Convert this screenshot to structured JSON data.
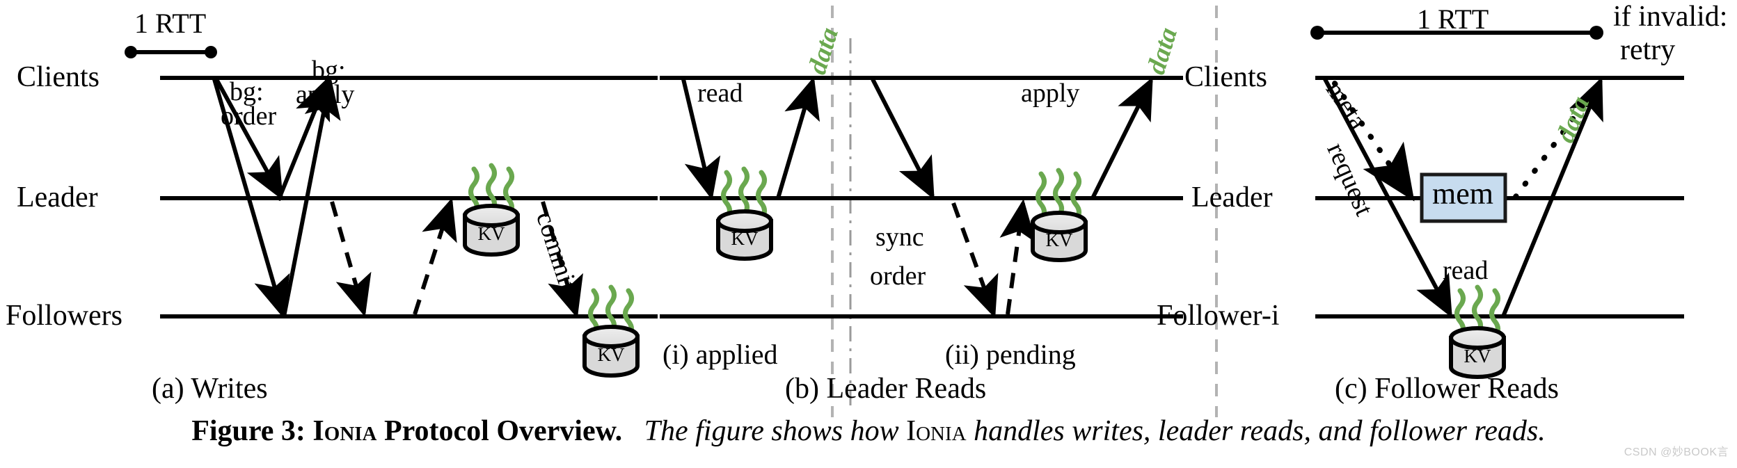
{
  "figure": {
    "caption_prefix": "Figure 3:",
    "caption_name": "Ionia",
    "caption_bold_tail": "Protocol Overview.",
    "caption_italic_a": "The figure shows how",
    "caption_italic_name": "Ionia",
    "caption_italic_b": "handles writes, leader reads, and follower reads.",
    "watermark": "CSDN @妙BOOK言"
  },
  "colors": {
    "line": "#000000",
    "green": "#6aa84f",
    "mem_fill": "#c7dcef",
    "mem_stroke": "#1a1a1a",
    "kv_fill": "#d9d9d9",
    "kv_stroke": "#000000",
    "divider": "#b3b3b3"
  },
  "panel_a": {
    "caption": "(a) Writes",
    "rtt_label": "1 RTT",
    "rows": [
      {
        "label": "Clients"
      },
      {
        "label": "Leader"
      },
      {
        "label": "Followers"
      }
    ],
    "messages": [
      {
        "label": "bg:",
        "kind": "dashed"
      },
      {
        "label": "order",
        "kind": "dashed"
      },
      {
        "label": "bg:",
        "kind": "dashed"
      },
      {
        "label": "apply",
        "kind": "dashed"
      },
      {
        "label": "commit",
        "kind": "dashed"
      }
    ],
    "store_label": "KV",
    "store_count": 2
  },
  "panel_b": {
    "caption": "(b) Leader Reads",
    "sub_captions": [
      "(i) applied",
      "(ii) pending"
    ],
    "rows": [
      {
        "label": "Clients"
      },
      {
        "label": "Leader"
      },
      {
        "label": "Followers"
      }
    ],
    "messages": [
      {
        "label": "read",
        "kind": "solid"
      },
      {
        "label": "data",
        "kind": "solid-green"
      },
      {
        "label": "sync",
        "kind": "text"
      },
      {
        "label": "order",
        "kind": "text"
      },
      {
        "label": "apply",
        "kind": "dashed"
      },
      {
        "label": "data",
        "kind": "solid-green"
      }
    ],
    "store_label": "KV",
    "store_count": 2
  },
  "panel_c": {
    "caption": "(c) Follower Reads",
    "rtt_label": "1 RTT",
    "invalid_label": "if invalid:",
    "retry_label": "retry",
    "mem_label": "mem",
    "rows": [
      {
        "label": "Clients"
      },
      {
        "label": "Leader"
      },
      {
        "label": "Follower-i"
      }
    ],
    "messages": [
      {
        "label": "meta",
        "kind": "dotted"
      },
      {
        "label": "request",
        "kind": "solid"
      },
      {
        "label": "read",
        "kind": "solid"
      },
      {
        "label": "data",
        "kind": "solid-green"
      }
    ],
    "store_label": "KV",
    "store_count": 1
  }
}
